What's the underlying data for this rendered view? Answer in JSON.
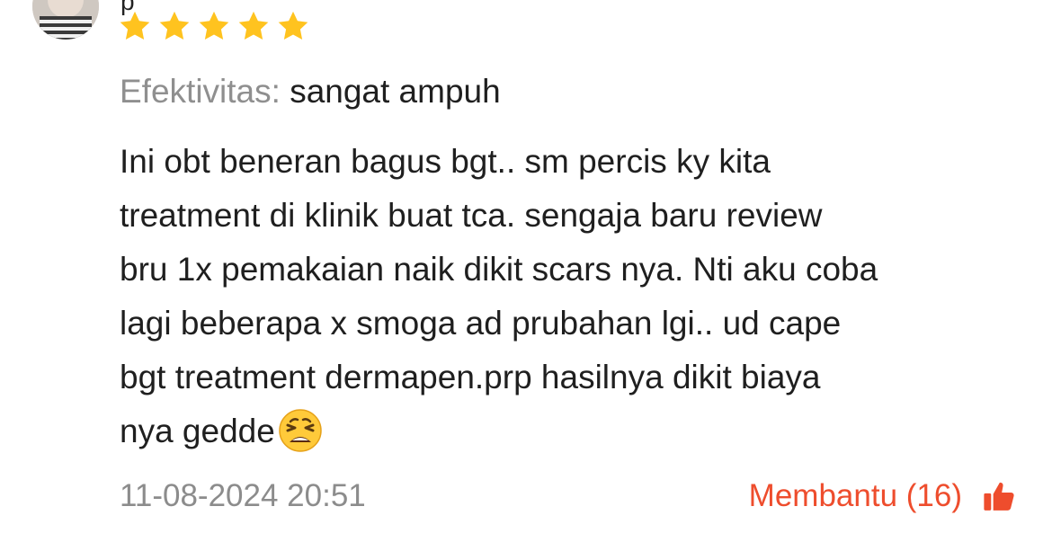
{
  "review": {
    "username_fragment": "p",
    "rating": 5,
    "rating_max": 5,
    "star_color": "#ffc31f",
    "attribute": {
      "label": "Efektivitas:",
      "value": "sangat ampuh"
    },
    "text_lines": [
      "Ini obt beneran bagus bgt.. sm percis ky kita",
      "treatment di klinik buat tca. sengaja baru review",
      "bru 1x pemakaian naik dikit scars nya. Nti aku coba",
      "lagi beberapa x smoga ad prubahan lgi.. ud cape",
      "bgt treatment dermapen.prp hasilnya dikit biaya",
      "nya gedde"
    ],
    "emoji_icon": "tired-face-emoji",
    "timestamp": "11-08-2024 20:51",
    "helpful": {
      "label": "Membantu (16)",
      "icon": "thumbs-up-icon",
      "color": "#ee4d2d"
    }
  }
}
